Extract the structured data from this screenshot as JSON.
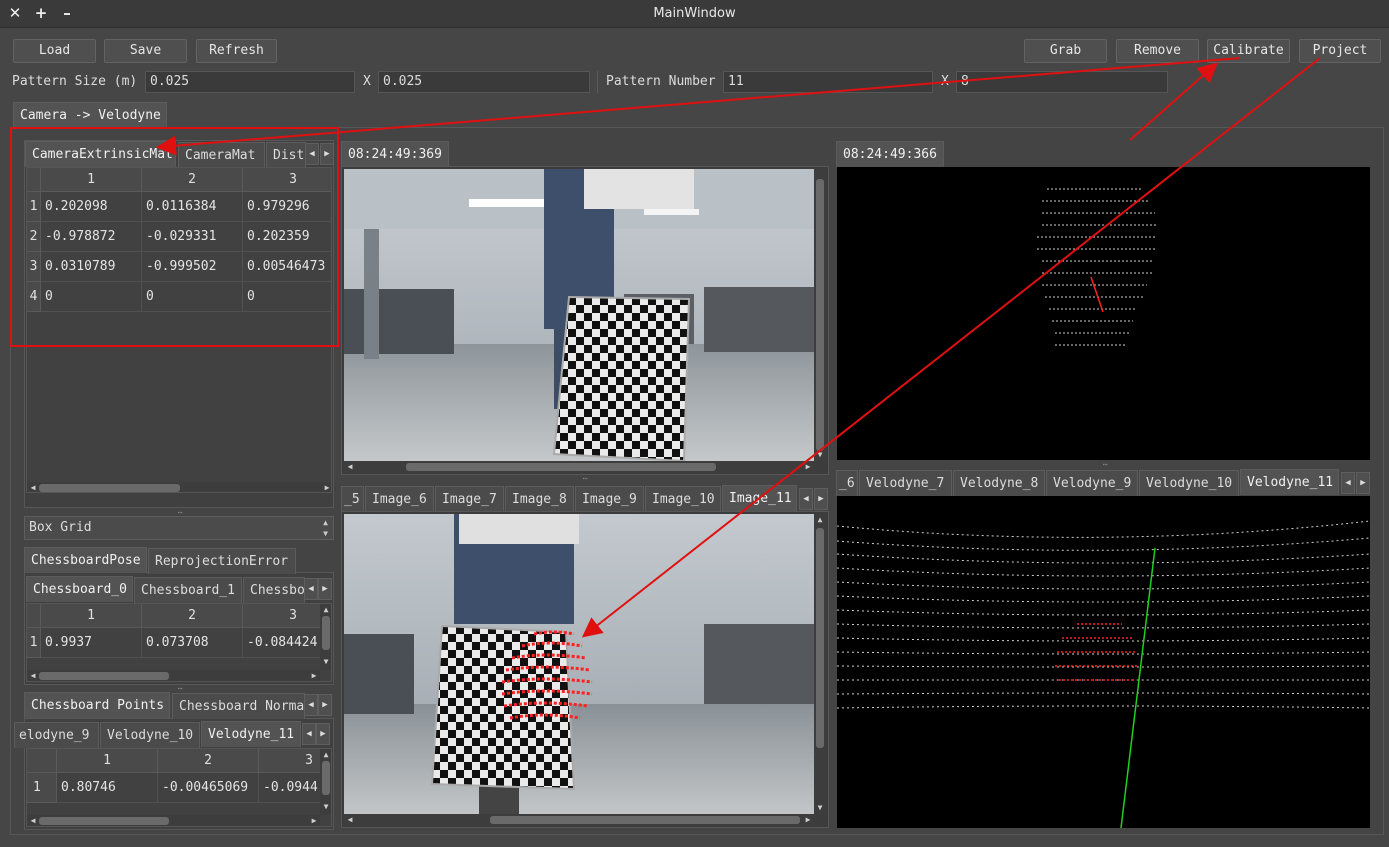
{
  "window": {
    "title": "MainWindow",
    "close": "✕",
    "maximize": "+",
    "minimize": "–"
  },
  "toolbar": {
    "load": "Load",
    "save": "Save",
    "refresh": "Refresh",
    "grab": "Grab",
    "remove": "Remove",
    "calibrate": "Calibrate",
    "project": "Project"
  },
  "pattern": {
    "size_label": "Pattern Size (m)",
    "size_x": "0.025",
    "x_sep": "X",
    "size_y": "0.025",
    "number_label": "Pattern Number",
    "number_x": "11",
    "number_sep": "X",
    "number_y": "8"
  },
  "main_tab": "Camera -> Velodyne",
  "extrinsic": {
    "tabs": [
      "CameraExtrinsicMat",
      "CameraMat",
      "Dist"
    ],
    "columns": [
      "1",
      "2",
      "3"
    ],
    "rows": [
      {
        "h": "1",
        "c": [
          "0.202098",
          "0.0116384",
          "0.979296"
        ]
      },
      {
        "h": "2",
        "c": [
          "-0.978872",
          "-0.029331",
          "0.202359"
        ]
      },
      {
        "h": "3",
        "c": [
          "0.0310789",
          "-0.999502",
          "0.00546473"
        ]
      },
      {
        "h": "4",
        "c": [
          "0",
          "0",
          "0"
        ]
      }
    ]
  },
  "box_grid": "Box Grid",
  "pose": {
    "tabs": [
      "ChessboardPose",
      "ReprojectionError"
    ],
    "subtabs": [
      "Chessboard_0",
      "Chessboard_1",
      "Chessbo"
    ],
    "columns": [
      "1",
      "2",
      "3"
    ],
    "rows": [
      {
        "h": "1",
        "c": [
          "0.9937",
          "0.073708",
          "-0.084424"
        ]
      }
    ]
  },
  "points": {
    "tabs": [
      "Chessboard Points",
      "Chessboard Norma"
    ],
    "subtabs": [
      "elodyne_9",
      "Velodyne_10",
      "Velodyne_11"
    ],
    "columns": [
      "1",
      "2",
      "3"
    ],
    "rows": [
      {
        "h": "1",
        "c": [
          "0.80746",
          "-0.00465069",
          "-0.0944"
        ]
      }
    ]
  },
  "camera_view": {
    "timestamp": "08:24:49:369"
  },
  "lidar_view": {
    "timestamp": "08:24:49:366"
  },
  "image_tabs": [
    "_5",
    "Image_6",
    "Image_7",
    "Image_8",
    "Image_9",
    "Image_10",
    "Image_11"
  ],
  "velodyne_tabs": [
    "_6",
    "Velodyne_7",
    "Velodyne_8",
    "Velodyne_9",
    "Velodyne_10",
    "Velodyne_11"
  ],
  "colors": {
    "annotation_red": "#e01010",
    "lidar_axis_green": "#20d020",
    "projected_points": "#ff2020"
  }
}
